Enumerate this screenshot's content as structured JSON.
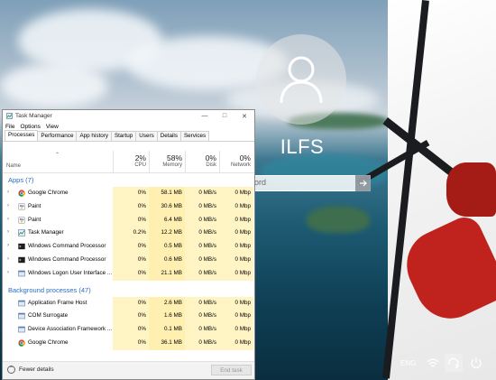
{
  "login": {
    "username": "ILFS",
    "password_placeholder": "Password",
    "visible_password_text": "ord"
  },
  "tray": {
    "language": "ENG"
  },
  "task_manager": {
    "title": "Task Manager",
    "menu": [
      "File",
      "Options",
      "View"
    ],
    "tabs": [
      "Processes",
      "Performance",
      "App history",
      "Startup",
      "Users",
      "Details",
      "Services"
    ],
    "active_tab": "Processes",
    "columns": {
      "name": "Name",
      "cpu": {
        "pct": "2%",
        "label": "CPU"
      },
      "memory": {
        "pct": "58%",
        "label": "Memory"
      },
      "disk": {
        "pct": "0%",
        "label": "Disk"
      },
      "network": {
        "pct": "0%",
        "label": "Network"
      }
    },
    "apps_header": "Apps (7)",
    "apps": [
      {
        "name": "Google Chrome",
        "cpu": "0%",
        "mem": "58.1 MB",
        "disk": "0 MB/s",
        "net": "0 Mbp",
        "icon": "chrome-icon"
      },
      {
        "name": "Paint",
        "cpu": "0%",
        "mem": "30.6 MB",
        "disk": "0 MB/s",
        "net": "0 Mbp",
        "icon": "paint-icon"
      },
      {
        "name": "Paint",
        "cpu": "0%",
        "mem": "6.4 MB",
        "disk": "0 MB/s",
        "net": "0 Mbp",
        "icon": "paint-icon"
      },
      {
        "name": "Task Manager",
        "cpu": "0.2%",
        "mem": "12.2 MB",
        "disk": "0 MB/s",
        "net": "0 Mbp",
        "icon": "taskmgr-icon"
      },
      {
        "name": "Windows Command Processor",
        "cpu": "0%",
        "mem": "0.5 MB",
        "disk": "0 MB/s",
        "net": "0 Mbp",
        "icon": "cmd-icon"
      },
      {
        "name": "Windows Command Processor",
        "cpu": "0%",
        "mem": "0.6 MB",
        "disk": "0 MB/s",
        "net": "0 Mbp",
        "icon": "cmd-icon"
      },
      {
        "name": "Windows Logon User Interface ...",
        "cpu": "0%",
        "mem": "21.1 MB",
        "disk": "0 MB/s",
        "net": "0 Mbp",
        "icon": "window-icon"
      }
    ],
    "bg_header": "Background processes (47)",
    "background": [
      {
        "name": "Application Frame Host",
        "cpu": "0%",
        "mem": "2.6 MB",
        "disk": "0 MB/s",
        "net": "0 Mbp",
        "icon": "window-icon"
      },
      {
        "name": "COM Surrogate",
        "cpu": "0%",
        "mem": "1.6 MB",
        "disk": "0 MB/s",
        "net": "0 Mbp",
        "icon": "window-icon"
      },
      {
        "name": "Device Association Framework ...",
        "cpu": "0%",
        "mem": "0.1 MB",
        "disk": "0 MB/s",
        "net": "0 Mbp",
        "icon": "window-icon"
      },
      {
        "name": "Google Chrome",
        "cpu": "0%",
        "mem": "36.1 MB",
        "disk": "0 MB/s",
        "net": "0 Mbp",
        "icon": "chrome-icon"
      }
    ],
    "footer": {
      "fewer_details": "Fewer details",
      "end_task": "End task"
    }
  }
}
